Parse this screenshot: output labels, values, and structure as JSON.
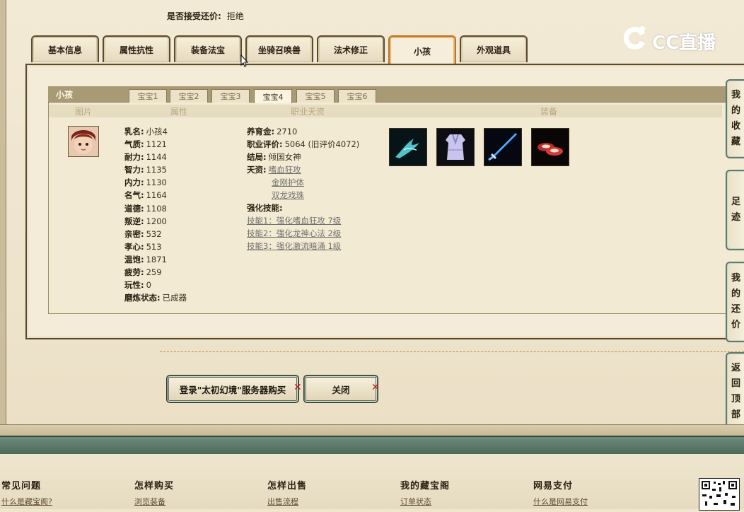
{
  "offer": {
    "label": "是否接受还价:",
    "value": "拒绝"
  },
  "tabs": [
    "基本信息",
    "属性抗性",
    "装备法宝",
    "坐骑召唤兽",
    "法术修正",
    "小孩",
    "外观道具"
  ],
  "active_tab": "小孩",
  "panel": {
    "title": "小孩",
    "subtabs": [
      "宝宝1",
      "宝宝2",
      "宝宝3",
      "宝宝4",
      "宝宝5",
      "宝宝6"
    ],
    "active_subtab": "宝宝4",
    "columns": [
      "图片",
      "属性",
      "职业天资",
      "装备"
    ]
  },
  "attributes": [
    {
      "k": "乳名:",
      "v": "小孩4"
    },
    {
      "k": "气质:",
      "v": "1121"
    },
    {
      "k": "耐力:",
      "v": "1144"
    },
    {
      "k": "智力:",
      "v": "1135"
    },
    {
      "k": "内力:",
      "v": "1130"
    },
    {
      "k": "名气:",
      "v": "1164"
    },
    {
      "k": "道德:",
      "v": "1108"
    },
    {
      "k": "叛逆:",
      "v": "1200"
    },
    {
      "k": "亲密:",
      "v": "532"
    },
    {
      "k": "孝心:",
      "v": "513"
    },
    {
      "k": "温饱:",
      "v": "1871"
    },
    {
      "k": "疲劳:",
      "v": "259"
    },
    {
      "k": "玩性:",
      "v": "0"
    },
    {
      "k": "磨炼状态:",
      "v": "已成器"
    }
  ],
  "job": {
    "fee_label": "养育金:",
    "fee": "2710",
    "rating_label": "职业评价:",
    "rating": "5064 (旧评价4072)",
    "ending_label": "结局:",
    "ending": "倾国女神",
    "talent_label": "天资:",
    "talents": [
      "嗜血狂攻",
      "金刚护体",
      "双龙戏珠"
    ],
    "skills_label": "强化技能:",
    "skills": [
      "技能1：强化嗜血狂攻 7级",
      "技能2：强化龙神心法 2级",
      "技能3：强化激流暗涌 1级"
    ]
  },
  "equipment_icons": [
    "spirit-bird-icon",
    "robe-icon",
    "sword-icon",
    "shoes-icon"
  ],
  "buttons": {
    "buy": "登录\"太初幻境\"服务器购买",
    "close": "关闭"
  },
  "side_tabs": [
    "我的收藏",
    "足迹",
    "我的还价",
    "返回顶部"
  ],
  "logo_text": "CC直播",
  "footer": [
    {
      "h": "常见问题",
      "l": "什么是藏宝阁?"
    },
    {
      "h": "怎样购买",
      "l": "浏览装备"
    },
    {
      "h": "怎样出售",
      "l": "出售流程"
    },
    {
      "h": "我的藏宝阁",
      "l": "订单状态"
    },
    {
      "h": "网易支付",
      "l": "什么是网易支付"
    }
  ]
}
